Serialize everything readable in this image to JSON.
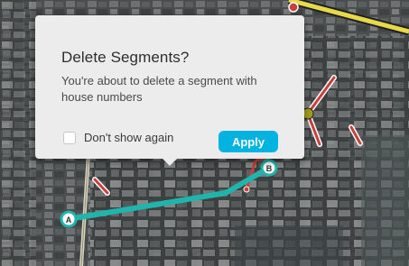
{
  "dialog": {
    "title": "Delete Segments?",
    "message": "You're about to delete a segment with house numbers",
    "checkbox_label": "Don't show again",
    "checkbox_checked": false,
    "apply_label": "Apply"
  },
  "map": {
    "node_a_label": "A",
    "node_b_label": "B",
    "selected_segment_color": "#1fb5ad",
    "segment_color": "#c9403a",
    "road_color": "#e8d94a"
  }
}
